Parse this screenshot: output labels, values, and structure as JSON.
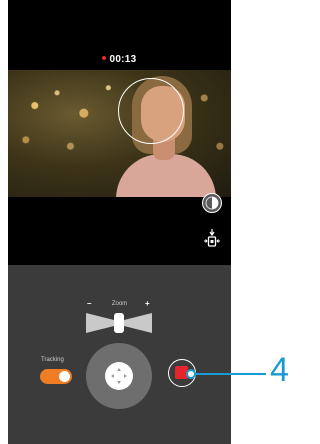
{
  "status": {
    "recording_time": "00:13",
    "recording_dot_color": "#e62b2b"
  },
  "preview": {
    "face_tracking_frame": "face-tracking-circle",
    "icons": {
      "exposure": "exposure-icon",
      "orientation": "orientation-lock-icon"
    }
  },
  "controls": {
    "zoom": {
      "label": "Zoom",
      "minus": "–",
      "plus": "+",
      "level": 0.5
    },
    "tracking": {
      "label": "Tracking",
      "enabled": true,
      "color": "#f07d22"
    },
    "joystick_icon": "joystick-icon",
    "record": {
      "state": "recording",
      "color": "#e5252b"
    }
  },
  "callout": {
    "number": "4",
    "color": "#1a9ad2"
  }
}
